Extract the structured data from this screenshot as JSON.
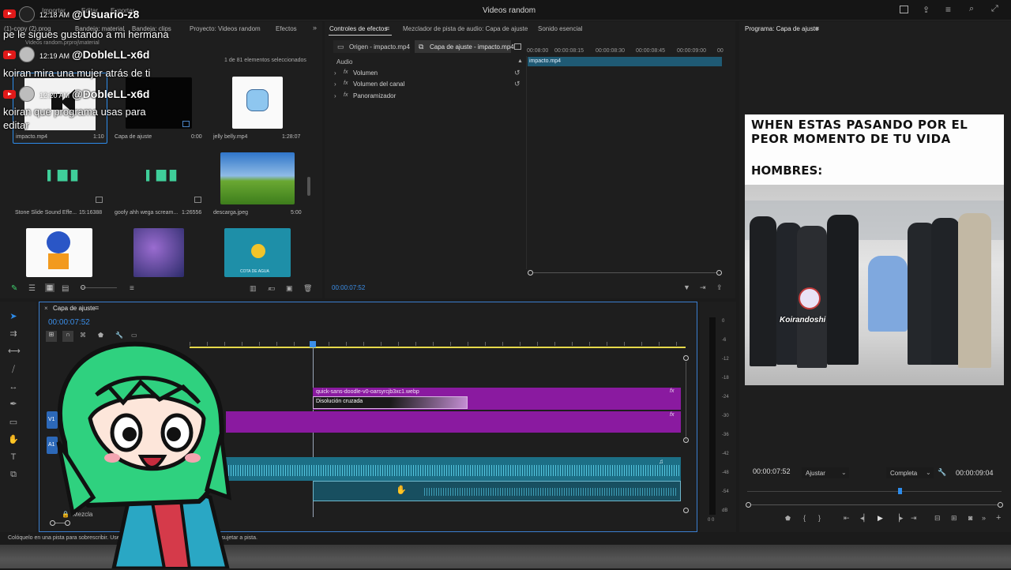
{
  "app": {
    "title": "Videos random",
    "menu": [
      "Importar",
      "Editar",
      "Exportar"
    ]
  },
  "project": {
    "tabs": [
      "(1)-copy (2).prog",
      "Bandeja: material",
      "Bandeja: clips",
      "Proyecto: Videos random",
      "Efectos"
    ],
    "path": "Videos random.prproj\\material",
    "count": "1 de 81 elementos seleccionados",
    "items": [
      {
        "name": "impacto.mp4",
        "dur": "1:10"
      },
      {
        "name": "Capa de ajuste",
        "dur": "0:00"
      },
      {
        "name": "jelly belly.mp4",
        "dur": "1:28:07"
      },
      {
        "name": "Stone Slide Sound Effe...",
        "dur": "15:16388"
      },
      {
        "name": "goofy ahh wega scream...",
        "dur": "1:26556"
      },
      {
        "name": "descarga.jpeg",
        "dur": "5:00"
      },
      {
        "name": "",
        "dur": ""
      },
      {
        "name": "",
        "dur": ""
      },
      {
        "name": "COTA DE AGUA",
        "dur": ""
      }
    ]
  },
  "effects": {
    "tabs": [
      "Controles de efectos",
      "Mezclador de pista de audio: Capa de ajuste",
      "Sonido esencial"
    ],
    "subtabs": [
      "Origen - impacto.mp4",
      "Capa de ajuste - impacto.mp4"
    ],
    "section": "Audio",
    "rows": [
      "Volumen",
      "Volumen del canal",
      "Panoramizador"
    ],
    "ruler": [
      "00:08:00",
      "00:00:08:15",
      "00:00:08:30",
      "00:00:08:45",
      "00:00:09:00",
      "00"
    ],
    "clip": "impacto.mp4",
    "timecode": "00:00:07:52"
  },
  "program": {
    "title": "Programa: Capa de ajuste",
    "meme_top": "WHEN ESTAS PASANDO POR EL PEOR MOMENTO DE TU VIDA",
    "meme_mid": "HOMBRES:",
    "watermark": "Koirandoshi",
    "timecode": "00:00:07:52",
    "fit": "Ajustar",
    "quality": "Completa",
    "duration": "00:00:09:04"
  },
  "timeline": {
    "tab": "Capa de ajuste",
    "timecode": "00:00:07:52",
    "clip_top": "quick-sans-doodle-v0-oarsyrcjb3xc1.webp",
    "transition": "Disolución cruzada",
    "fx": "fx",
    "track_v": "V1",
    "track_a": "A1",
    "mix": "Mezcla"
  },
  "meter": {
    "ticks": [
      "0",
      "-6",
      "-12",
      "-18",
      "-24",
      "-30",
      "-36",
      "-42",
      "-48",
      "-54",
      "dB"
    ],
    "bottom": "0  0"
  },
  "status": {
    "text": "Colóquelo en una pista para sobrescribir. Use Alt para duplicar el clip. Use Mayús para sujetar a pista."
  },
  "chat": [
    {
      "time": "12:18 AM",
      "user": "@Usuario-z8",
      "msg": "pe le sigues gustando a mi hermana"
    },
    {
      "time": "12:19 AM",
      "user": "@DobleLL-x6d",
      "msg": "koiran mira una mujer atrás de ti"
    },
    {
      "time": "12:20 AM",
      "user": "@DobleLL-x6d",
      "msg": "koiran que programa usas para"
    },
    {
      "msg2": "editar"
    }
  ],
  "colors": {
    "accent": "#2d8ceb",
    "clip_purple": "#8a1aa0",
    "audio_teal": "#1c6f86",
    "youtube": "#e01919",
    "yellow": "#e6d84a"
  }
}
